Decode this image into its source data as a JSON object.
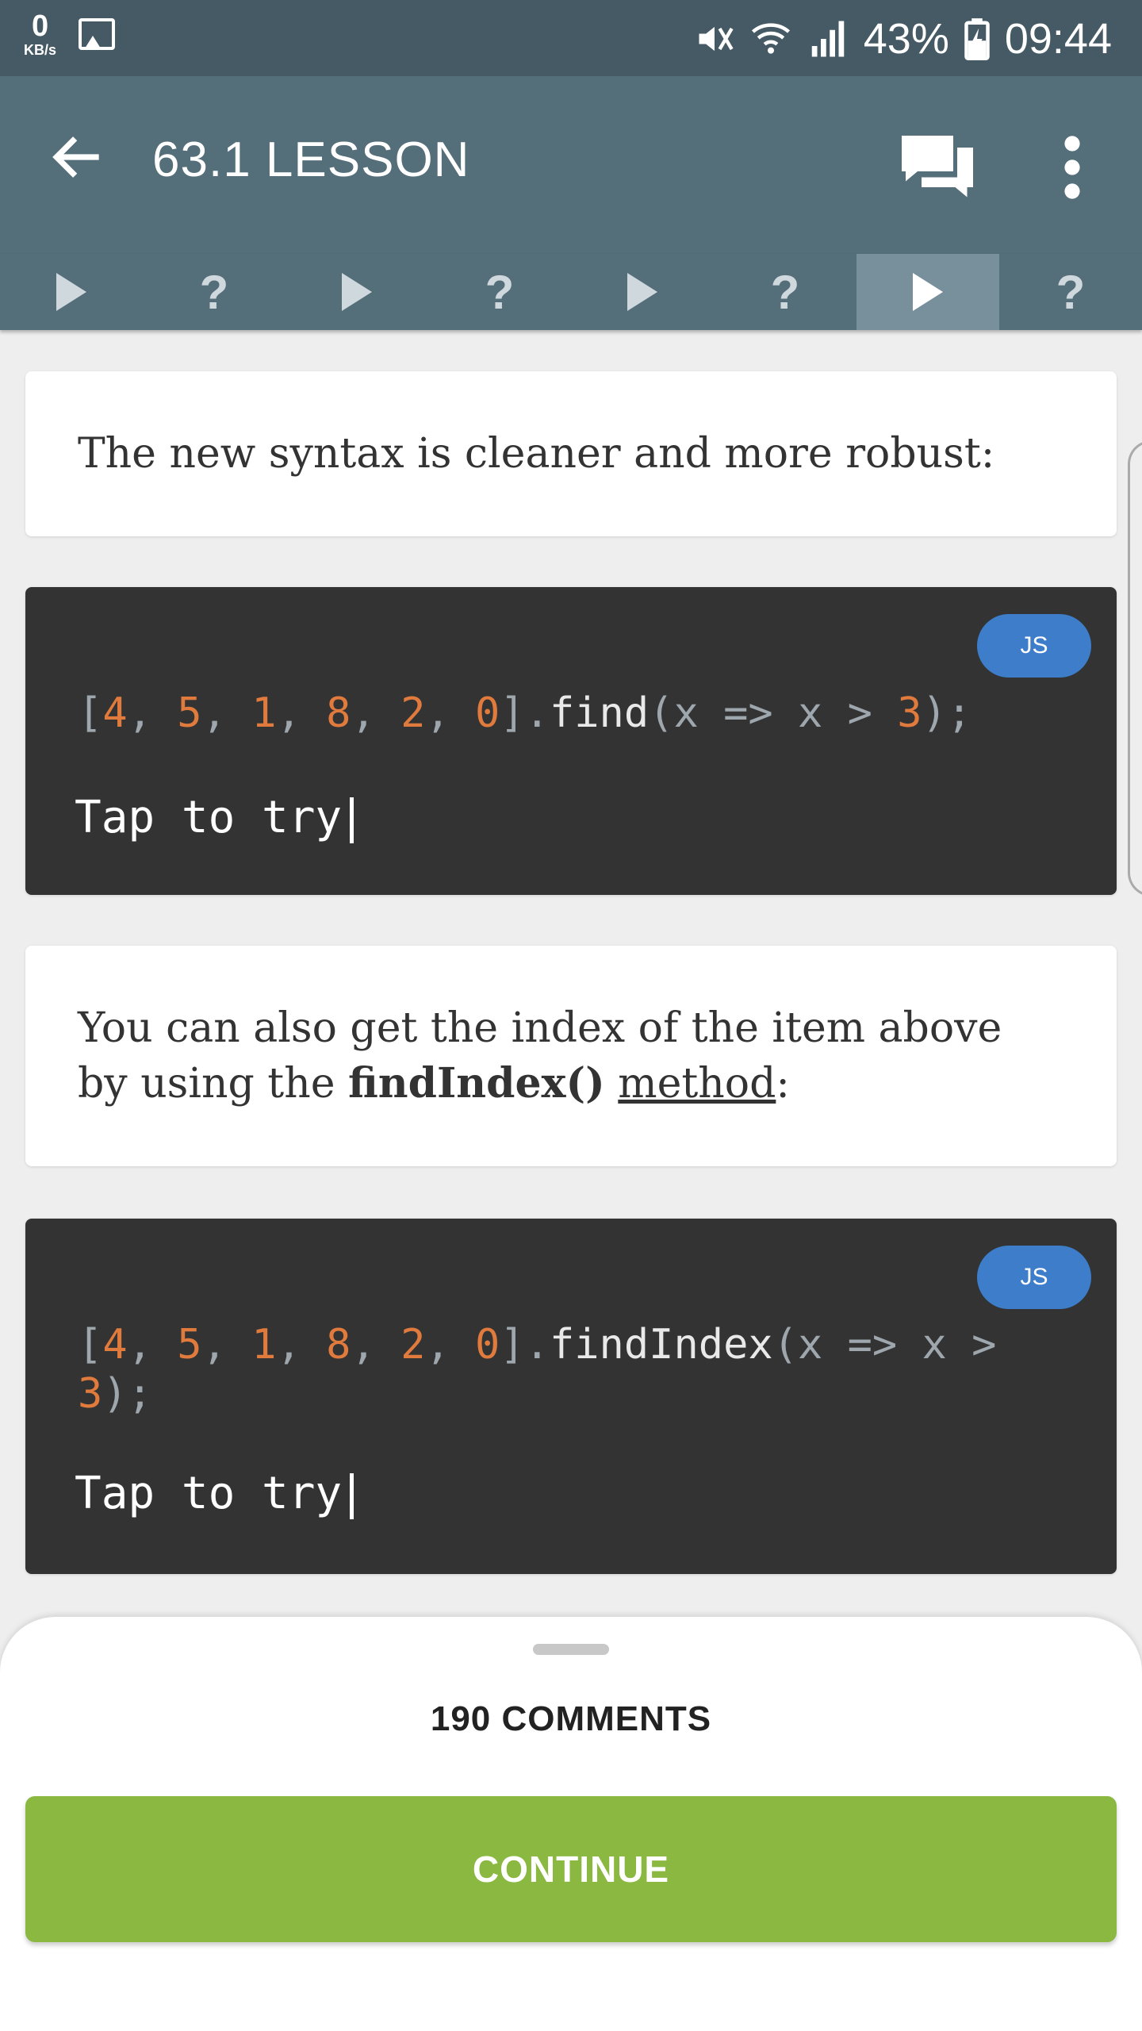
{
  "status_bar": {
    "net_speed_value": "0",
    "net_speed_unit": "KB/s",
    "battery": "43%",
    "time": "09:44"
  },
  "app_bar": {
    "title": "63.1 LESSON"
  },
  "tabs": [
    {
      "kind": "play-icon"
    },
    {
      "kind": "question",
      "label": "?"
    },
    {
      "kind": "play-icon"
    },
    {
      "kind": "question",
      "label": "?"
    },
    {
      "kind": "play-icon"
    },
    {
      "kind": "question",
      "label": "?"
    },
    {
      "kind": "play-icon",
      "active": true
    },
    {
      "kind": "question",
      "label": "?"
    }
  ],
  "content": {
    "intro_text": "The new syntax is cleaner and more robust:",
    "code1": {
      "badge": "JS",
      "code": "[4, 5, 1, 8, 2, 0].find(x => x > 3);",
      "tap_label": "Tap to try"
    },
    "text2": {
      "before": "You can also get the index of the item above by using the ",
      "bold": "findIndex()",
      "link": "method",
      "after": ":"
    },
    "code2": {
      "badge": "JS",
      "code": "[4, 5, 1, 8, 2, 0].findIndex(x => x > 3);",
      "tap_label": "Tap to try"
    }
  },
  "bottom_sheet": {
    "comments_label": "190 COMMENTS",
    "continue_label": "CONTINUE"
  },
  "colors": {
    "status_bar": "#455a64",
    "app_bar": "#546e7a",
    "code_bg": "#333333",
    "number_token": "#e07b3d",
    "badge": "#3d7dca",
    "continue": "#8ab840"
  }
}
